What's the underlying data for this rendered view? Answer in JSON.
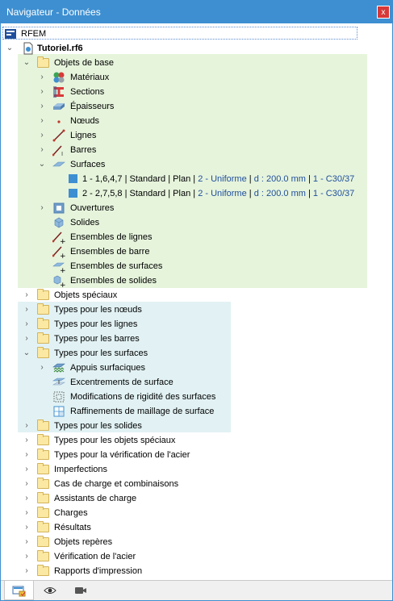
{
  "window": {
    "title": "Navigateur - Données",
    "close_label": "x"
  },
  "tree": {
    "root": "RFEM",
    "model": "Tutoriel.rf6",
    "base_objects": "Objets de base",
    "materials": "Matériaux",
    "sections": "Sections",
    "thicknesses": "Épaisseurs",
    "nodes": "Nœuds",
    "lines": "Lignes",
    "members": "Barres",
    "surfaces": "Surfaces",
    "surface_1": {
      "id": "1 - 1,6,4,7",
      "parts": [
        "Standard",
        "Plan",
        "2 - Uniforme",
        "d : 200.0 mm",
        "1 - C30/37"
      ]
    },
    "surface_2": {
      "id": "2 - 2,7,5,8",
      "parts": [
        "Standard",
        "Plan",
        "2 - Uniforme",
        "d : 200.0 mm",
        "1 - C30/37"
      ]
    },
    "openings": "Ouvertures",
    "solids": "Solides",
    "line_sets": "Ensembles de lignes",
    "member_sets": "Ensembles de barre",
    "surface_sets": "Ensembles de surfaces",
    "solid_sets": "Ensembles de solides",
    "special_objects": "Objets spéciaux",
    "node_types": "Types pour les nœuds",
    "line_types": "Types pour les lignes",
    "member_types": "Types pour les barres",
    "surface_types": "Types pour les surfaces",
    "surface_supports": "Appuis surfaciques",
    "surface_eccentricities": "Excentrements de surface",
    "surface_stiffness_mods": "Modifications de rigidité des surfaces",
    "surface_mesh_refinements": "Raffinements de maillage de surface",
    "solid_types": "Types pour les solides",
    "special_object_types": "Types pour les objets spéciaux",
    "steel_design_types": "Types pour la vérification de l'acier",
    "imperfections": "Imperfections",
    "load_cases": "Cas de charge et combinaisons",
    "load_wizards": "Assistants de charge",
    "loads": "Charges",
    "results": "Résultats",
    "guide_objects": "Objets repères",
    "steel_design": "Vérification de l'acier",
    "printout_reports": "Rapports d'impression"
  },
  "colors": {
    "title_bar": "#3d8fd1",
    "base_objects_bg": "#e6f4dc",
    "types_bg": "#e2f2f4",
    "surface_color": "#3d8fd1",
    "detail_text": "#1f4e9c"
  },
  "bottom_tabs": [
    "data-navigator-icon",
    "view-eye-icon",
    "camera-icon"
  ]
}
